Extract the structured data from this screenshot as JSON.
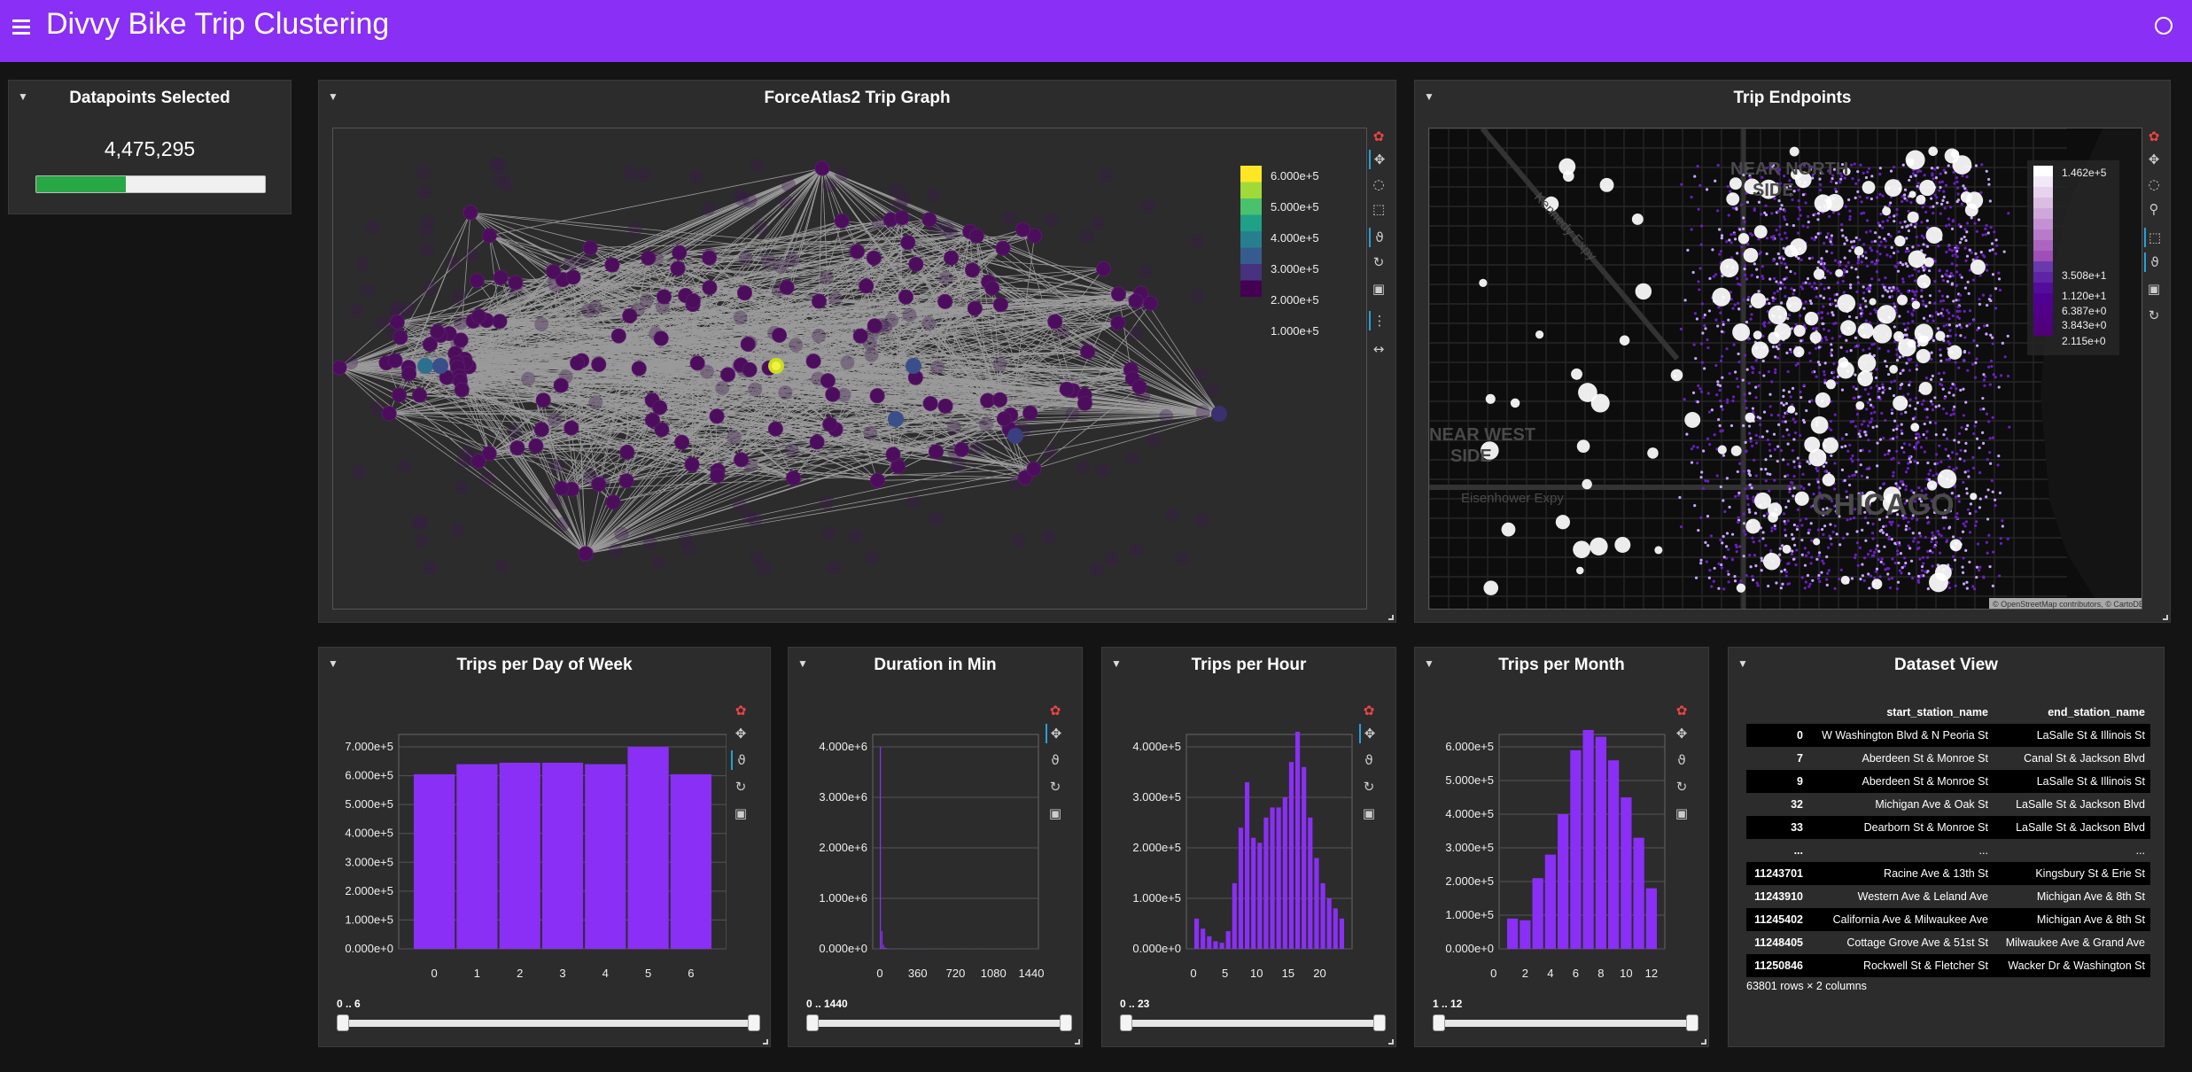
{
  "header": {
    "title": "Divvy Bike Trip Clustering"
  },
  "panels": {
    "datapoints": {
      "title": "Datapoints Selected",
      "value": "4,475,295",
      "fraction": 0.39
    },
    "graph": {
      "title": "ForceAtlas2 Trip Graph",
      "colorbar": [
        "6.000e+5",
        "5.000e+5",
        "4.000e+5",
        "3.000e+5",
        "2.000e+5",
        "1.000e+5"
      ]
    },
    "map": {
      "title": "Trip Endpoints",
      "colorbar": [
        "1.462e+5",
        "3.508e+1",
        "1.120e+1",
        "6.387e+0",
        "3.843e+0",
        "2.115e+0"
      ],
      "labels": [
        "NEAR NORTH",
        "SIDE",
        "NEAR WEST",
        "SIDE",
        "CHICAGO",
        "Kennedy Expy",
        "Eisenhower Expy"
      ],
      "attribution": "© OpenStreetMap contributors, © CartoDB"
    },
    "dow": {
      "title": "Trips per Day of Week",
      "slider": "0 .. 6"
    },
    "duration": {
      "title": "Duration in Min",
      "slider": "0 .. 1440"
    },
    "hour": {
      "title": "Trips per Hour",
      "slider": "0 .. 23"
    },
    "month": {
      "title": "Trips per Month",
      "slider": "1 .. 12"
    },
    "dataset": {
      "title": "Dataset View",
      "columns": [
        "start_station_name",
        "end_station_name"
      ],
      "rows": [
        [
          "0",
          "W Washington Blvd & N Peoria St",
          "LaSalle St & Illinois St"
        ],
        [
          "7",
          "Aberdeen St & Monroe St",
          "Canal St & Jackson Blvd"
        ],
        [
          "9",
          "Aberdeen St & Monroe St",
          "LaSalle St & Illinois St"
        ],
        [
          "32",
          "Michigan Ave & Oak St",
          "LaSalle St & Jackson Blvd"
        ],
        [
          "33",
          "Dearborn St & Monroe St",
          "LaSalle St & Jackson Blvd"
        ],
        [
          "...",
          "...",
          "..."
        ],
        [
          "11243701",
          "Racine Ave & 13th St",
          "Kingsbury St & Erie St"
        ],
        [
          "11243910",
          "Western Ave & Leland Ave",
          "Michigan Ave & 8th St"
        ],
        [
          "11245402",
          "California Ave & Milwaukee Ave",
          "Michigan Ave & 8th St"
        ],
        [
          "11248405",
          "Cottage Grove Ave & 51st St",
          "Milwaukee Ave & Grand Ave"
        ],
        [
          "11250846",
          "Rockwell St & Fletcher St",
          "Wacker Dr & Washington St"
        ]
      ],
      "footer": "63801 rows × 2 columns"
    }
  },
  "chart_data": [
    {
      "type": "bar",
      "title": "Trips per Day of Week",
      "categories": [
        "0",
        "1",
        "2",
        "3",
        "4",
        "5",
        "6"
      ],
      "values": [
        605000,
        640000,
        645000,
        645000,
        640000,
        700000,
        605000
      ],
      "ylim": [
        0,
        700000
      ],
      "yticks": [
        "0.000e+0",
        "1.000e+5",
        "2.000e+5",
        "3.000e+5",
        "4.000e+5",
        "5.000e+5",
        "6.000e+5",
        "7.000e+5"
      ],
      "xticks": [
        "0",
        "1",
        "2",
        "3",
        "4",
        "5",
        "6"
      ],
      "color": "#8a2ff5"
    },
    {
      "type": "bar",
      "title": "Duration in Min",
      "x": [
        0,
        15,
        30,
        45,
        60,
        75,
        90,
        105,
        120,
        240,
        360,
        480,
        600,
        720,
        840,
        960,
        1080,
        1200,
        1320
      ],
      "values": [
        4000000,
        350000,
        80000,
        30000,
        15000,
        9000,
        6000,
        4000,
        3000,
        2000,
        1500,
        1200,
        1000,
        900,
        800,
        700,
        600,
        500,
        400
      ],
      "ylim": [
        0,
        4000000
      ],
      "yticks": [
        "0.000e+0",
        "1.000e+6",
        "2.000e+6",
        "3.000e+6",
        "4.000e+6"
      ],
      "xticks": [
        "0",
        "360",
        "720",
        "1080",
        "1440"
      ],
      "color": "#8a2ff5"
    },
    {
      "type": "bar",
      "title": "Trips per Hour",
      "categories": [
        "0",
        "1",
        "2",
        "3",
        "4",
        "5",
        "6",
        "7",
        "8",
        "9",
        "10",
        "11",
        "12",
        "13",
        "14",
        "15",
        "16",
        "17",
        "18",
        "19",
        "20",
        "21",
        "22",
        "23"
      ],
      "values": [
        60000,
        40000,
        25000,
        15000,
        12000,
        35000,
        130000,
        240000,
        330000,
        220000,
        210000,
        260000,
        280000,
        280000,
        300000,
        370000,
        430000,
        360000,
        260000,
        180000,
        130000,
        100000,
        80000,
        60000
      ],
      "ylim": [
        0,
        400000
      ],
      "yticks": [
        "0.000e+0",
        "1.000e+5",
        "2.000e+5",
        "3.000e+5",
        "4.000e+5"
      ],
      "xticks": [
        "0",
        "5",
        "10",
        "15",
        "20"
      ],
      "color": "#8a2ff5"
    },
    {
      "type": "bar",
      "title": "Trips per Month",
      "categories": [
        "1",
        "2",
        "3",
        "4",
        "5",
        "6",
        "7",
        "8",
        "9",
        "10",
        "11",
        "12"
      ],
      "values": [
        90000,
        85000,
        210000,
        280000,
        400000,
        590000,
        650000,
        630000,
        560000,
        450000,
        330000,
        180000
      ],
      "ylim": [
        0,
        600000
      ],
      "yticks": [
        "0.000e+0",
        "1.000e+5",
        "2.000e+5",
        "3.000e+5",
        "4.000e+5",
        "5.000e+5",
        "6.000e+5"
      ],
      "xticks": [
        "0",
        "2",
        "4",
        "6",
        "8",
        "10",
        "12"
      ],
      "color": "#8a2ff5"
    }
  ]
}
